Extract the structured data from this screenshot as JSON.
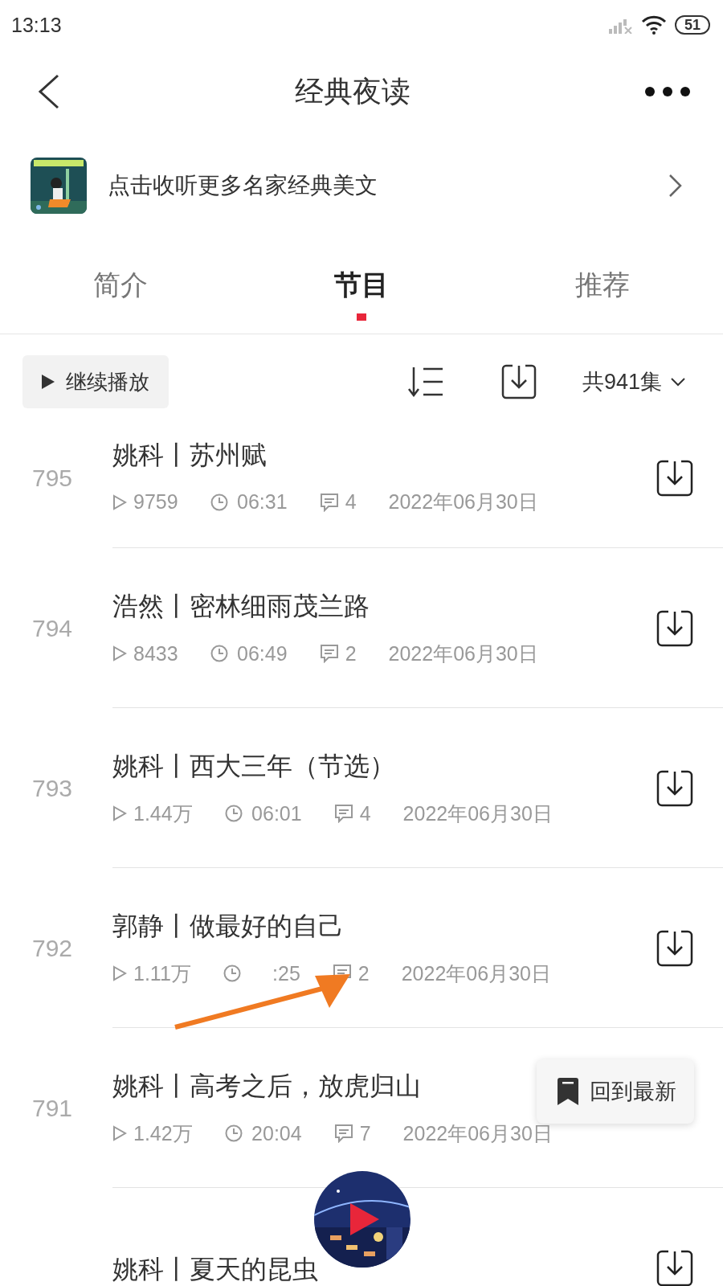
{
  "status_bar": {
    "time": "13:13",
    "battery": "51"
  },
  "header": {
    "title": "经典夜读"
  },
  "banner": {
    "text": "点击收听更多名家经典美文"
  },
  "tabs": [
    {
      "label": "简介",
      "selected": false
    },
    {
      "label": "节目",
      "selected": true
    },
    {
      "label": "推荐",
      "selected": false
    }
  ],
  "toolbar": {
    "continue_button": "继续播放",
    "episode_count": "共941集"
  },
  "episodes": [
    {
      "number": "795",
      "title": "姚科丨苏州赋",
      "plays": "9759",
      "duration": "06:31",
      "comments": "4",
      "date": "2022年06月30日"
    },
    {
      "number": "794",
      "title": "浩然丨密林细雨茂兰路",
      "plays": "8433",
      "duration": "06:49",
      "comments": "2",
      "date": "2022年06月30日"
    },
    {
      "number": "793",
      "title": "姚科丨西大三年（节选）",
      "plays": "1.44万",
      "duration": "06:01",
      "comments": "4",
      "date": "2022年06月30日"
    },
    {
      "number": "792",
      "title": "郭静丨做最好的自己",
      "plays": "1.11万",
      "duration": ":25",
      "comments": "2",
      "date": "2022年06月30日"
    },
    {
      "number": "791",
      "title": "姚科丨高考之后，放虎归山",
      "plays": "1.42万",
      "duration": "20:04",
      "comments": "7",
      "date": "2022年06月30日"
    },
    {
      "title": "姚科丨夏天的昆虫"
    }
  ],
  "back_to_latest": {
    "label": "回到最新"
  }
}
